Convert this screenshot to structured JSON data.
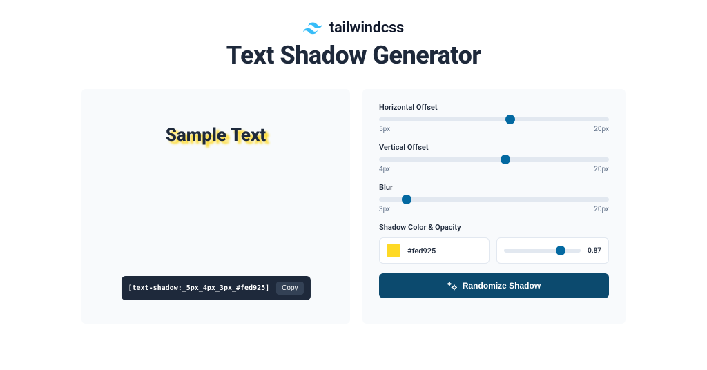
{
  "header": {
    "brand": "tailwindcss",
    "title": "Text Shadow Generator"
  },
  "preview": {
    "sample_text": "Sample Text",
    "code": "[text-shadow:_5px_4px_3px_#fed925]",
    "copy_label": "Copy"
  },
  "controls": {
    "horizontal": {
      "label": "Horizontal Offset",
      "value": "5px",
      "max": "20px",
      "thumb_pct": 57
    },
    "vertical": {
      "label": "Vertical Offset",
      "value": "4px",
      "max": "20px",
      "thumb_pct": 55
    },
    "blur": {
      "label": "Blur",
      "value": "3px",
      "max": "20px",
      "thumb_pct": 12
    },
    "color_opacity": {
      "label": "Shadow Color & Opacity",
      "color_hex": "#fed925",
      "opacity": "0.87",
      "opacity_thumb_pct": 74
    },
    "randomize_label": "Randomize Shadow"
  },
  "colors": {
    "brand_cyan": "#38bdf8",
    "swatch": "#fed925"
  }
}
